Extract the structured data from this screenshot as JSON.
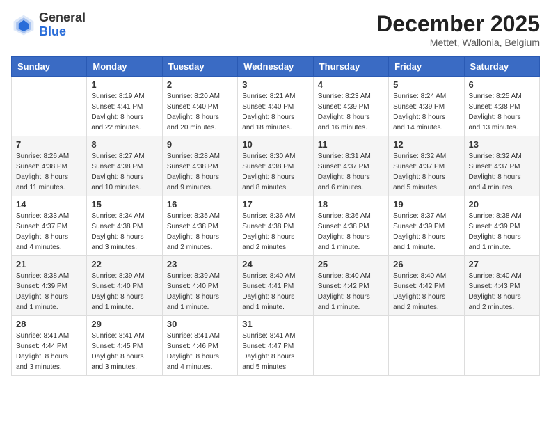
{
  "header": {
    "logo": {
      "general": "General",
      "blue": "Blue"
    },
    "title": "December 2025",
    "subtitle": "Mettet, Wallonia, Belgium"
  },
  "calendar": {
    "days_of_week": [
      "Sunday",
      "Monday",
      "Tuesday",
      "Wednesday",
      "Thursday",
      "Friday",
      "Saturday"
    ],
    "weeks": [
      [
        {
          "day": "",
          "info": ""
        },
        {
          "day": "1",
          "info": "Sunrise: 8:19 AM\nSunset: 4:41 PM\nDaylight: 8 hours\nand 22 minutes."
        },
        {
          "day": "2",
          "info": "Sunrise: 8:20 AM\nSunset: 4:40 PM\nDaylight: 8 hours\nand 20 minutes."
        },
        {
          "day": "3",
          "info": "Sunrise: 8:21 AM\nSunset: 4:40 PM\nDaylight: 8 hours\nand 18 minutes."
        },
        {
          "day": "4",
          "info": "Sunrise: 8:23 AM\nSunset: 4:39 PM\nDaylight: 8 hours\nand 16 minutes."
        },
        {
          "day": "5",
          "info": "Sunrise: 8:24 AM\nSunset: 4:39 PM\nDaylight: 8 hours\nand 14 minutes."
        },
        {
          "day": "6",
          "info": "Sunrise: 8:25 AM\nSunset: 4:38 PM\nDaylight: 8 hours\nand 13 minutes."
        }
      ],
      [
        {
          "day": "7",
          "info": "Sunrise: 8:26 AM\nSunset: 4:38 PM\nDaylight: 8 hours\nand 11 minutes."
        },
        {
          "day": "8",
          "info": "Sunrise: 8:27 AM\nSunset: 4:38 PM\nDaylight: 8 hours\nand 10 minutes."
        },
        {
          "day": "9",
          "info": "Sunrise: 8:28 AM\nSunset: 4:38 PM\nDaylight: 8 hours\nand 9 minutes."
        },
        {
          "day": "10",
          "info": "Sunrise: 8:30 AM\nSunset: 4:38 PM\nDaylight: 8 hours\nand 8 minutes."
        },
        {
          "day": "11",
          "info": "Sunrise: 8:31 AM\nSunset: 4:37 PM\nDaylight: 8 hours\nand 6 minutes."
        },
        {
          "day": "12",
          "info": "Sunrise: 8:32 AM\nSunset: 4:37 PM\nDaylight: 8 hours\nand 5 minutes."
        },
        {
          "day": "13",
          "info": "Sunrise: 8:32 AM\nSunset: 4:37 PM\nDaylight: 8 hours\nand 4 minutes."
        }
      ],
      [
        {
          "day": "14",
          "info": "Sunrise: 8:33 AM\nSunset: 4:37 PM\nDaylight: 8 hours\nand 4 minutes."
        },
        {
          "day": "15",
          "info": "Sunrise: 8:34 AM\nSunset: 4:38 PM\nDaylight: 8 hours\nand 3 minutes."
        },
        {
          "day": "16",
          "info": "Sunrise: 8:35 AM\nSunset: 4:38 PM\nDaylight: 8 hours\nand 2 minutes."
        },
        {
          "day": "17",
          "info": "Sunrise: 8:36 AM\nSunset: 4:38 PM\nDaylight: 8 hours\nand 2 minutes."
        },
        {
          "day": "18",
          "info": "Sunrise: 8:36 AM\nSunset: 4:38 PM\nDaylight: 8 hours\nand 1 minute."
        },
        {
          "day": "19",
          "info": "Sunrise: 8:37 AM\nSunset: 4:39 PM\nDaylight: 8 hours\nand 1 minute."
        },
        {
          "day": "20",
          "info": "Sunrise: 8:38 AM\nSunset: 4:39 PM\nDaylight: 8 hours\nand 1 minute."
        }
      ],
      [
        {
          "day": "21",
          "info": "Sunrise: 8:38 AM\nSunset: 4:39 PM\nDaylight: 8 hours\nand 1 minute."
        },
        {
          "day": "22",
          "info": "Sunrise: 8:39 AM\nSunset: 4:40 PM\nDaylight: 8 hours\nand 1 minute."
        },
        {
          "day": "23",
          "info": "Sunrise: 8:39 AM\nSunset: 4:40 PM\nDaylight: 8 hours\nand 1 minute."
        },
        {
          "day": "24",
          "info": "Sunrise: 8:40 AM\nSunset: 4:41 PM\nDaylight: 8 hours\nand 1 minute."
        },
        {
          "day": "25",
          "info": "Sunrise: 8:40 AM\nSunset: 4:42 PM\nDaylight: 8 hours\nand 1 minute."
        },
        {
          "day": "26",
          "info": "Sunrise: 8:40 AM\nSunset: 4:42 PM\nDaylight: 8 hours\nand 2 minutes."
        },
        {
          "day": "27",
          "info": "Sunrise: 8:40 AM\nSunset: 4:43 PM\nDaylight: 8 hours\nand 2 minutes."
        }
      ],
      [
        {
          "day": "28",
          "info": "Sunrise: 8:41 AM\nSunset: 4:44 PM\nDaylight: 8 hours\nand 3 minutes."
        },
        {
          "day": "29",
          "info": "Sunrise: 8:41 AM\nSunset: 4:45 PM\nDaylight: 8 hours\nand 3 minutes."
        },
        {
          "day": "30",
          "info": "Sunrise: 8:41 AM\nSunset: 4:46 PM\nDaylight: 8 hours\nand 4 minutes."
        },
        {
          "day": "31",
          "info": "Sunrise: 8:41 AM\nSunset: 4:47 PM\nDaylight: 8 hours\nand 5 minutes."
        },
        {
          "day": "",
          "info": ""
        },
        {
          "day": "",
          "info": ""
        },
        {
          "day": "",
          "info": ""
        }
      ]
    ]
  }
}
